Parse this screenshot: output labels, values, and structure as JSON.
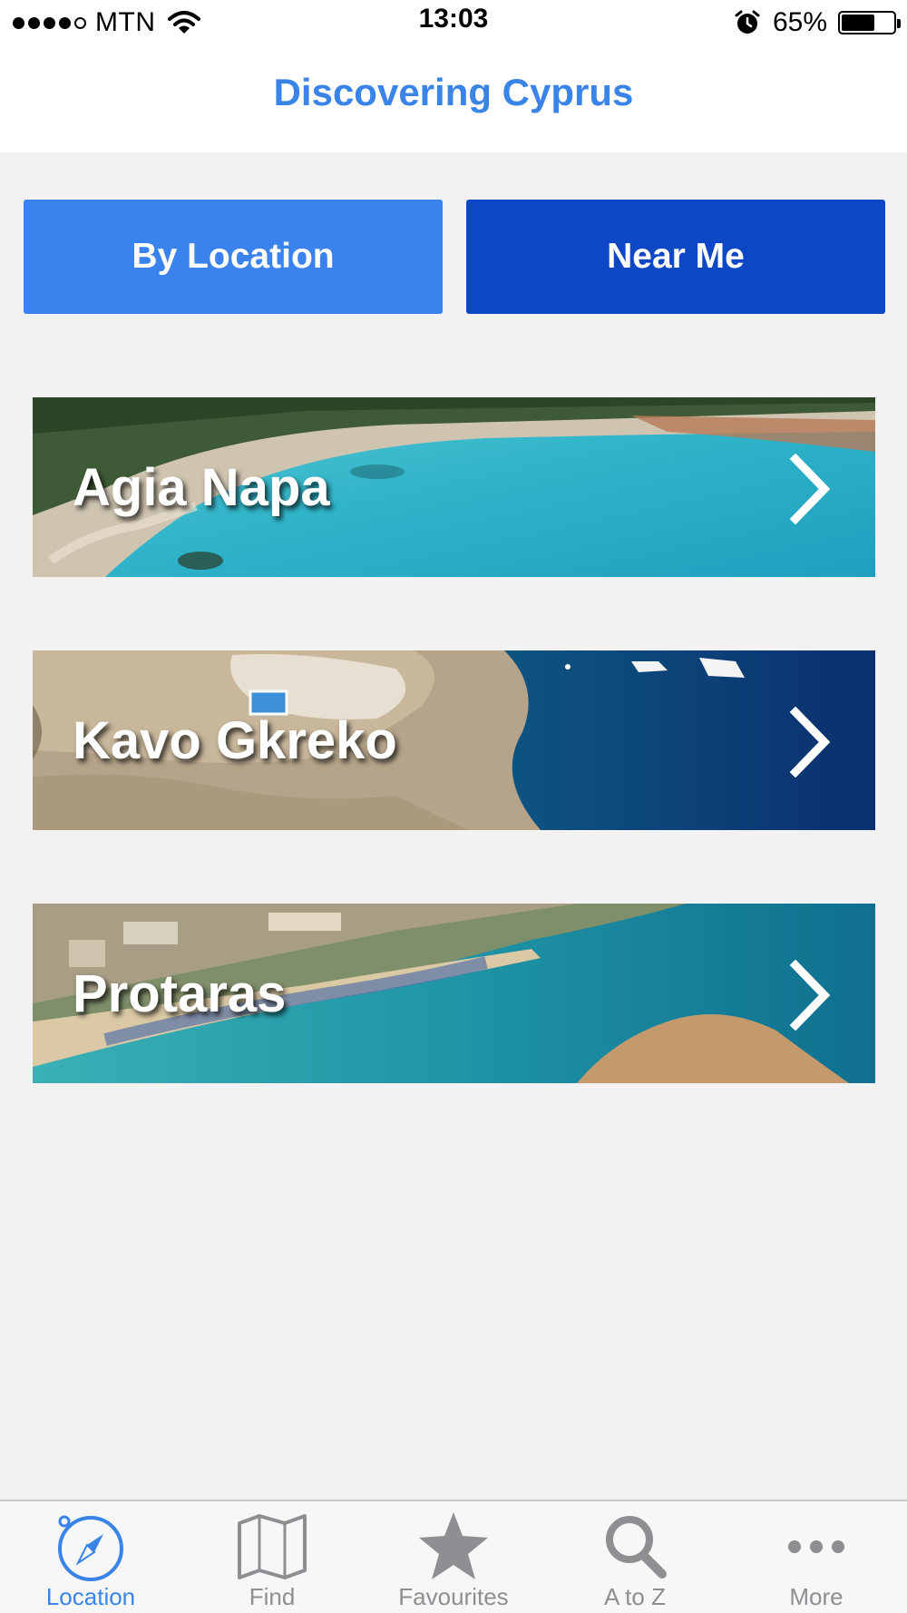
{
  "status_bar": {
    "carrier": "MTN",
    "time": "13:03",
    "battery": "65%",
    "battery_level": 0.65,
    "signal_bars_filled": 4,
    "signal_bars_total": 5
  },
  "nav": {
    "title": "Discovering Cyprus"
  },
  "segments": {
    "by_location": "By Location",
    "near_me": "Near Me"
  },
  "locations": [
    {
      "name": "Agia Napa"
    },
    {
      "name": "Kavo Gkreko"
    },
    {
      "name": "Protaras"
    }
  ],
  "tabs": [
    {
      "label": "Location",
      "icon": "compass-icon",
      "active": true
    },
    {
      "label": "Find",
      "icon": "map-icon",
      "active": false
    },
    {
      "label": "Favourites",
      "icon": "star-icon",
      "active": false
    },
    {
      "label": "A to Z",
      "icon": "search-icon",
      "active": false
    },
    {
      "label": "More",
      "icon": "more-icon",
      "active": false
    }
  ],
  "colors": {
    "accent": "#3a84e8",
    "by_location_bg": "#3a82ee",
    "near_me_bg": "#0d47c5",
    "tab_inactive": "#8e8e93"
  }
}
